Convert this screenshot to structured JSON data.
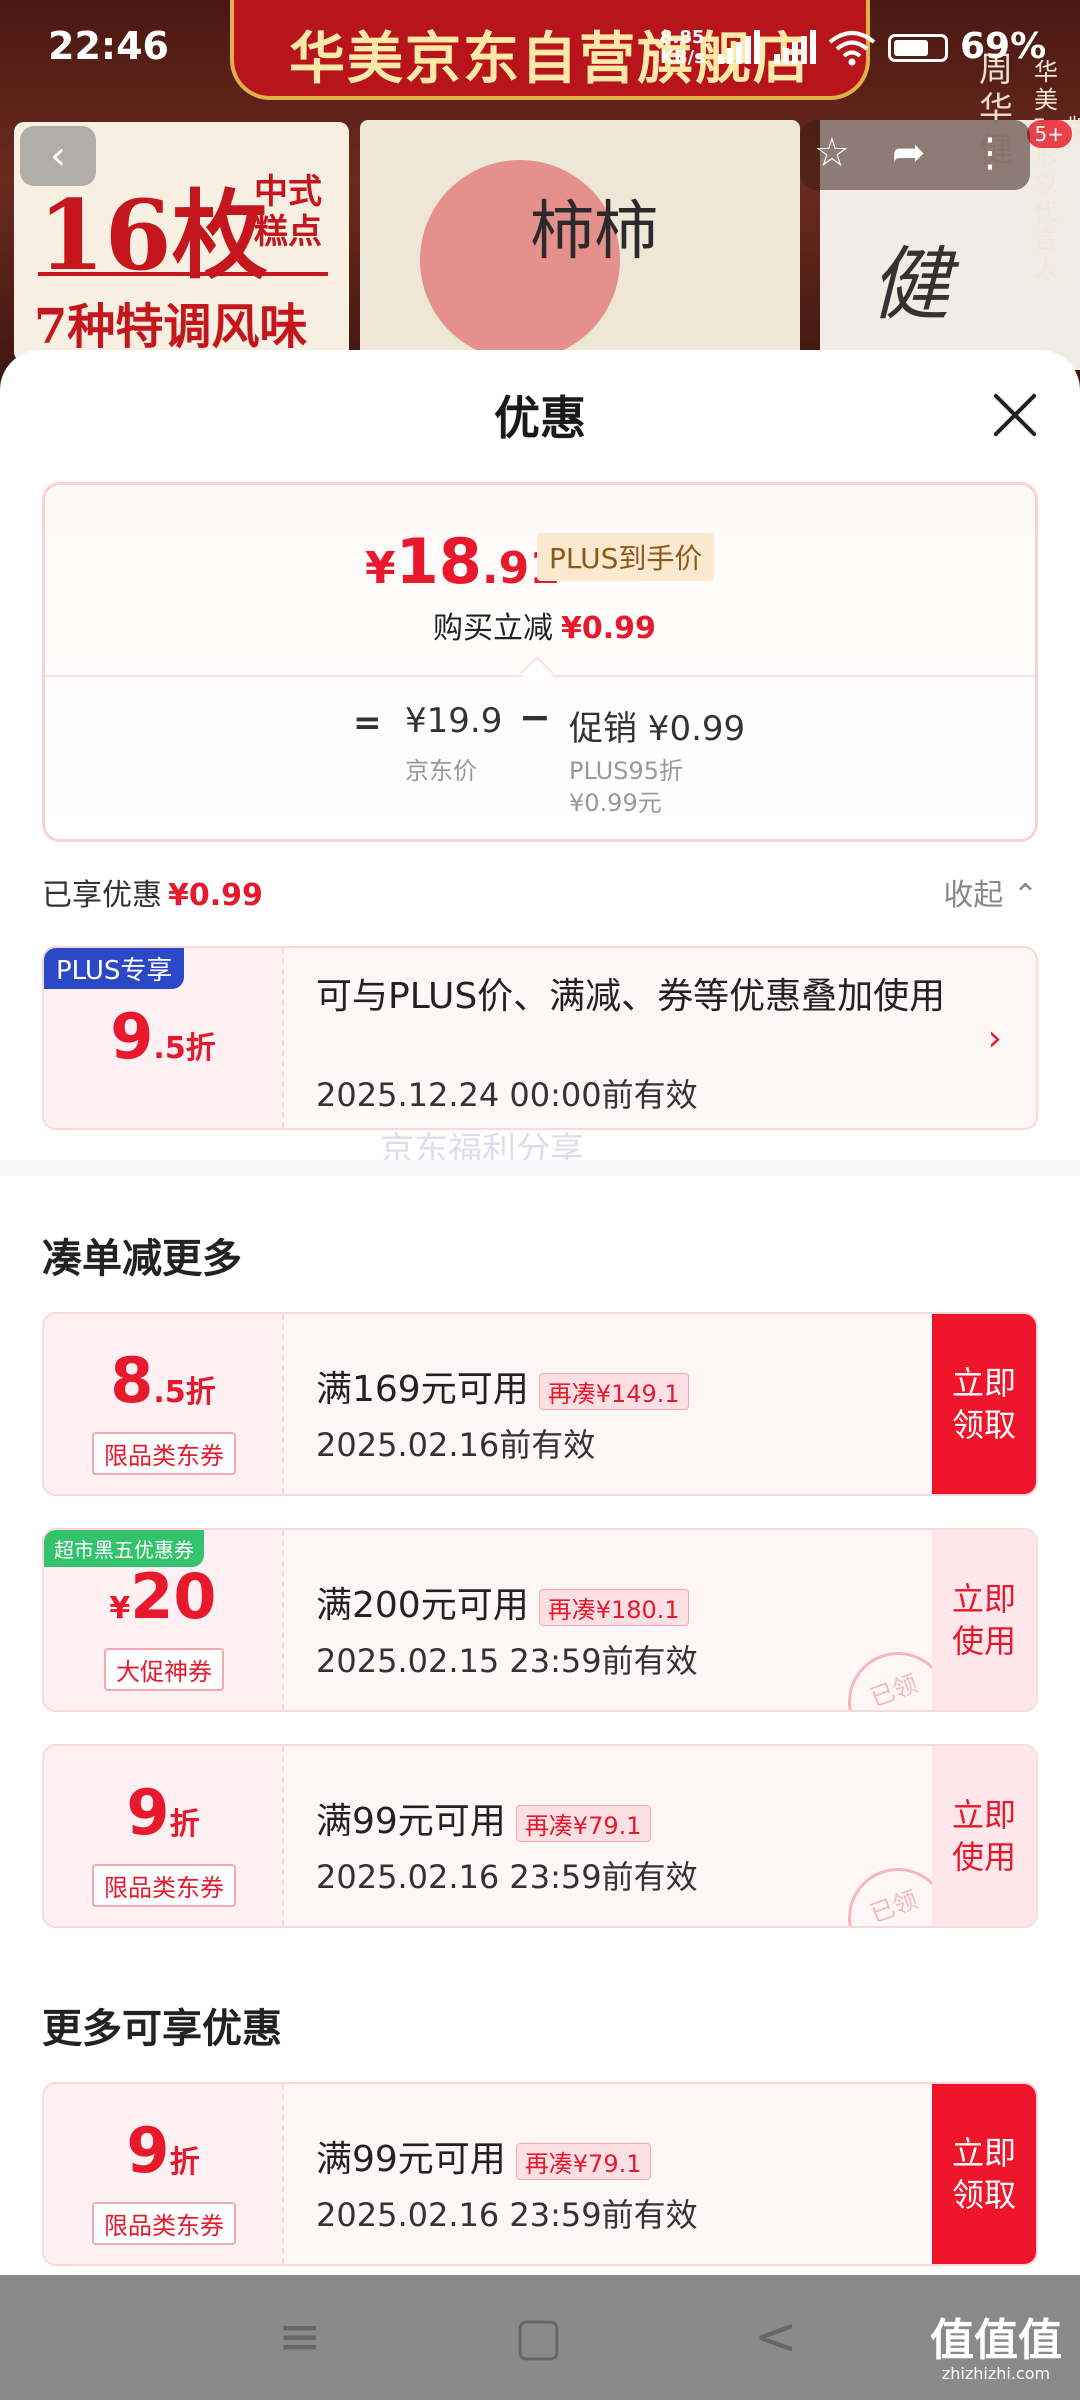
{
  "status_bar": {
    "time": "22:46",
    "net_speed": "8.85\nKB/s",
    "battery": "69%"
  },
  "banner": {
    "ribbon": "华美京东自营旗舰店",
    "left_big": "16枚",
    "left_cake": "中式\n糕点",
    "left_sub": "7种特调风味",
    "mid_ink": "柿柿",
    "vertical_text": "华美5+牌形象代言人",
    "vertical_name": "周华健",
    "badge": "5+"
  },
  "sheet": {
    "title": "优惠",
    "price_card": {
      "yen": "¥",
      "price_int": "18",
      "price_dec": ".91",
      "plus_tag": "PLUS到手价",
      "reduce_label": "购买立减",
      "reduce_value": "¥0.99",
      "eq": "=",
      "jd_price": "¥19.9",
      "jd_label": "京东价",
      "minus": "−",
      "promo": "促销 ¥0.99",
      "promo_sub1": "PLUS95折",
      "promo_sub2": "¥0.99元"
    },
    "enjoyed_label": "已享优惠",
    "enjoyed_value": "¥0.99",
    "collapse_label": "收起 ⌃",
    "plus_coupon": {
      "corner": "PLUS专享",
      "val_n": "9",
      "val_s": ".5折",
      "desc": "可与PLUS价、满减、券等优惠叠加使用",
      "expiry": "2025.12.24 00:00前有效"
    },
    "watermark": "京东福利分享",
    "section1_title": "凑单减更多",
    "coupons": [
      {
        "val_n": "8",
        "val_s": ".5折",
        "tagline": "限品类东券",
        "cond": "满169元可用",
        "tag": "再凑¥149.1",
        "exp": "2025.02.16前有效",
        "btn": "立即领取"
      },
      {
        "corner": "超市黑五优惠券",
        "val_s": "¥",
        "val_n": "20",
        "tagline": "大促神券",
        "cond": "满200元可用",
        "tag": "再凑¥180.1",
        "exp": "2025.02.15 23:59前有效",
        "btn": "立即使用",
        "stamp": "已领"
      },
      {
        "val_n": "9",
        "val_s": "折",
        "tagline": "限品类东券",
        "cond": "满99元可用",
        "tag": "再凑¥79.1",
        "exp": "2025.02.16 23:59前有效",
        "btn": "立即使用",
        "stamp": "已领"
      }
    ],
    "section2_title": "更多可享优惠",
    "more_coupons": [
      {
        "val_n": "9",
        "val_s": "折",
        "tagline": "限品类东券",
        "cond": "满99元可用",
        "tag": "再凑¥79.1",
        "exp": "2025.02.16 23:59前有效",
        "btn": "立即领取"
      }
    ]
  },
  "sysnav": {
    "menu": "≡",
    "home": "▢",
    "back": "<"
  },
  "site_mark": {
    "brand": "值值值",
    "url": "zhizhizhi.com"
  },
  "colors": {
    "accent": "#e8192c",
    "plus": "#2b48c6",
    "green": "#32c36c"
  },
  "icons": [
    "back-icon",
    "star-icon",
    "share-icon",
    "more-icon",
    "close-icon",
    "chevron-right-icon",
    "chevron-up-icon"
  ]
}
